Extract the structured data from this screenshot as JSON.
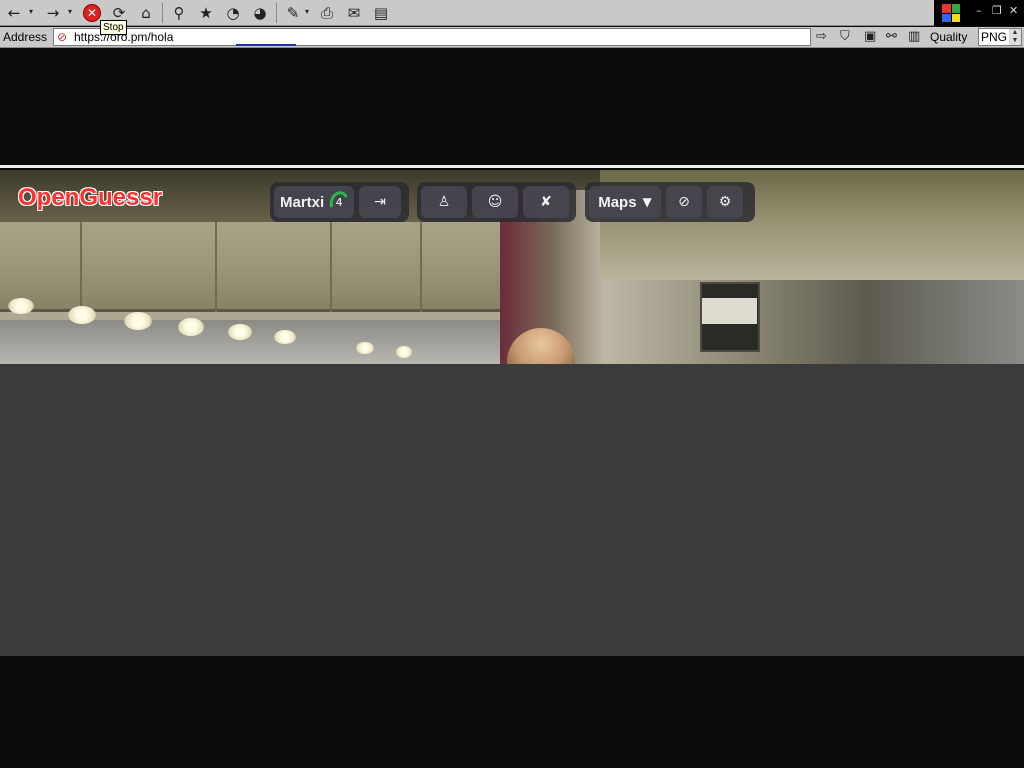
{
  "browser": {
    "toolbar": {
      "back_icon": "←",
      "forward_icon": "→",
      "stop_icon": "✕",
      "refresh_icon": "⟳",
      "home_icon": "⌂",
      "search_icon": "⚲",
      "favorites_icon": "★",
      "history_icon": "◔",
      "globe_icon": "◕",
      "edit_icon": "✎",
      "print_icon": "⎙",
      "mail_icon": "✉",
      "page_icon": "▤",
      "dropdown_icon": "▾"
    },
    "tooltip": "Stop",
    "window_controls": {
      "minimize": "–",
      "restore": "❐",
      "close": "✕"
    },
    "address_label": "Address",
    "url": "https://oro.pm/hola",
    "url_icon": "⊘",
    "go_icon": "⇨",
    "quality_label": "Quality",
    "format_value": "PNG",
    "accent_progress": "#2030b0"
  },
  "game": {
    "logo": "OpenGuessr",
    "profile": {
      "name": "Martxi",
      "level": "4"
    },
    "buttons": {
      "logout_icon": "⇥",
      "leaderboard_icon": "♙",
      "multiplayer_icon": "☺",
      "unlocked_icon": "✘",
      "maps_label": "Maps",
      "maps_caret": "▼",
      "no_move_icon": "⊘",
      "settings_icon": "⚙"
    },
    "colors": {
      "logo": "#ff3030",
      "level_ring": "#2fb84a",
      "panel": "#3b3b3b"
    }
  }
}
